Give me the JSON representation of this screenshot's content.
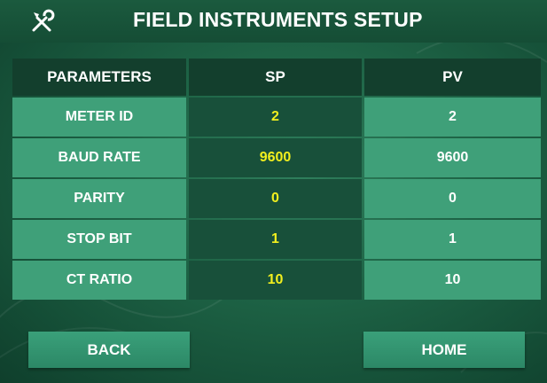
{
  "header": {
    "title": "FIELD INSTRUMENTS SETUP",
    "icon": "tools-icon"
  },
  "table": {
    "columns": [
      "PARAMETERS",
      "SP",
      "PV"
    ],
    "rows": [
      {
        "param": "METER ID",
        "sp": "2",
        "pv": "2"
      },
      {
        "param": "BAUD RATE",
        "sp": "9600",
        "pv": "9600"
      },
      {
        "param": "PARITY",
        "sp": "0",
        "pv": "0"
      },
      {
        "param": "STOP BIT",
        "sp": "1",
        "pv": "1"
      },
      {
        "param": "CT RATIO",
        "sp": "10",
        "pv": "10"
      }
    ]
  },
  "buttons": {
    "back": "BACK",
    "home": "HOME"
  },
  "colors": {
    "background": "#1e6446",
    "header_cell": "#133f2d",
    "param_cell": "#3fa079",
    "sp_cell": "#18503a",
    "sp_text": "#f2ef1e",
    "text": "#ffffff"
  }
}
